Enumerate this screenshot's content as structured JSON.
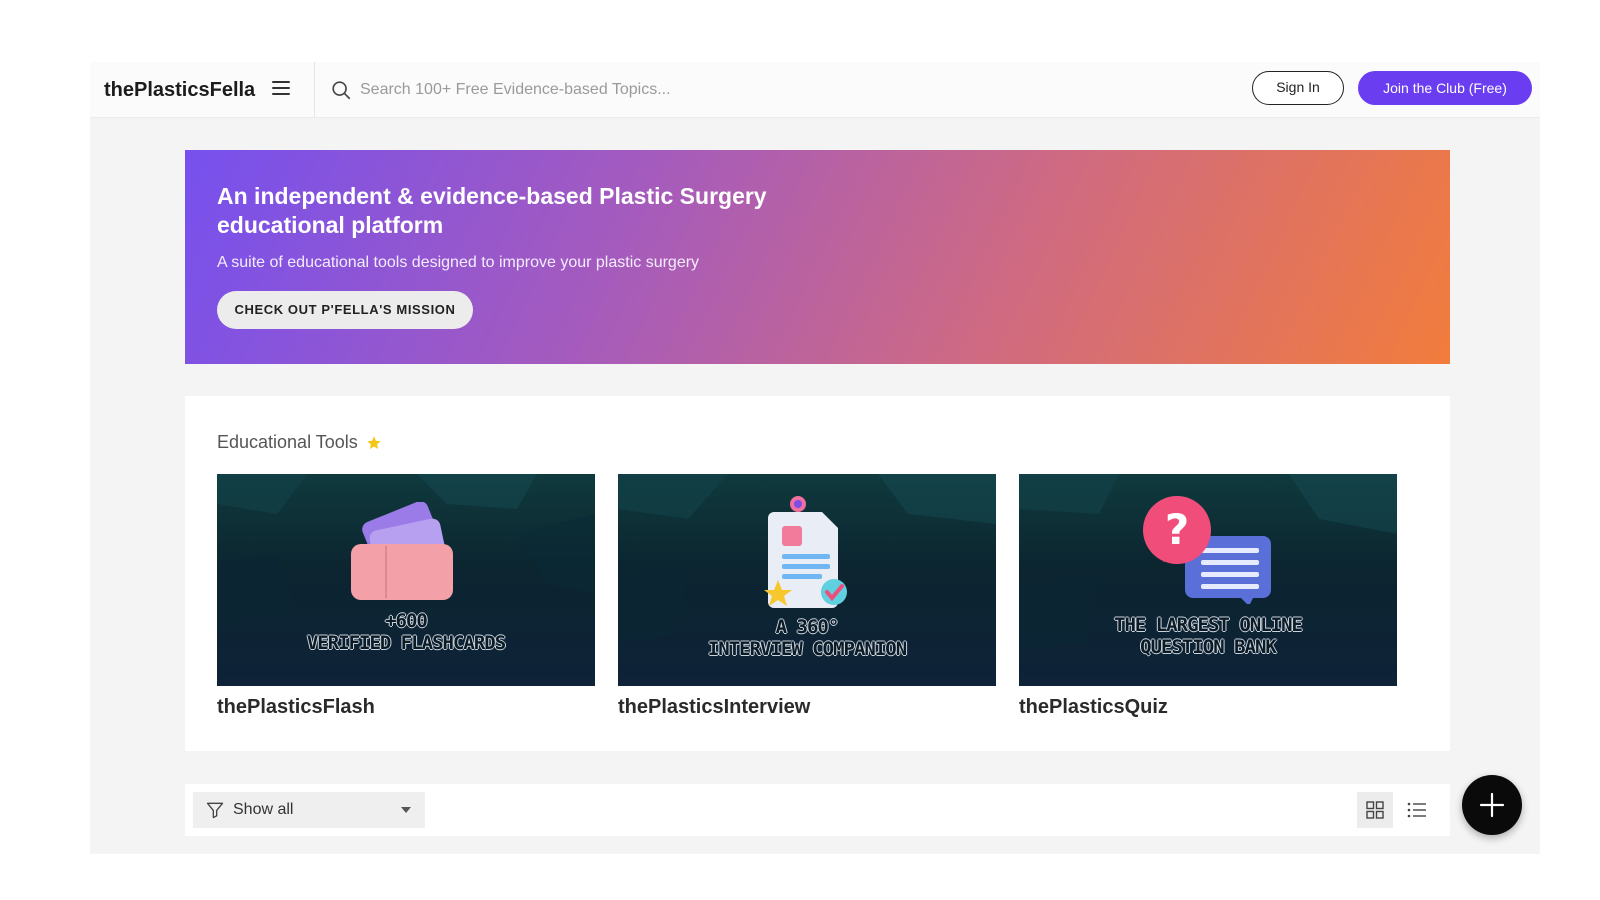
{
  "header": {
    "brand": "thePlasticsFella",
    "search_placeholder": "Search 100+ Free Evidence-based Topics...",
    "sign_in_label": "Sign In",
    "join_label": "Join the Club (Free)"
  },
  "hero": {
    "title": "An independent & evidence-based Plastic Surgery educational platform",
    "subtitle": "A suite of educational tools designed to improve your plastic surgery",
    "cta_label": "CHECK OUT P'FELLA'S MISSION"
  },
  "tools": {
    "title": "Educational Tools",
    "cards": [
      {
        "name": "thePlasticsFlash",
        "caption_line1": "+600",
        "caption_line2": "VERIFIED FLASHCARDS",
        "illustration": "flashcards-icon"
      },
      {
        "name": "thePlasticsInterview",
        "caption_line1": "A 360°",
        "caption_line2": "INTERVIEW COMPANION",
        "illustration": "resume-document-icon"
      },
      {
        "name": "thePlasticsQuiz",
        "caption_line1": "THE LARGEST ONLINE",
        "caption_line2": "QUESTION BANK",
        "illustration": "question-chat-icon"
      }
    ]
  },
  "filter": {
    "selected": "Show all"
  },
  "colors": {
    "accent": "#6a3df0",
    "hero_gradient_start": "#7650ee",
    "hero_gradient_end": "#f27c3c",
    "star": "#f5c518"
  }
}
